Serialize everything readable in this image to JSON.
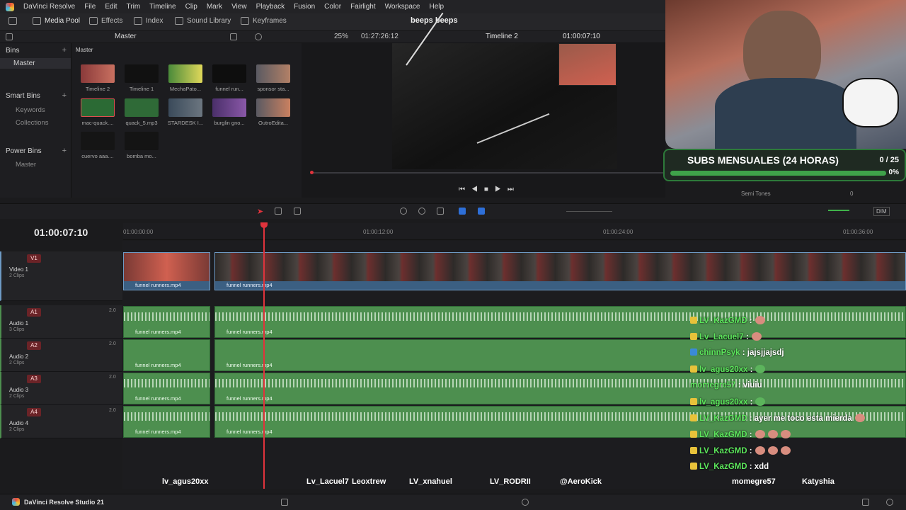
{
  "menu": {
    "app_name": "DaVinci Resolve",
    "items": [
      "File",
      "Edit",
      "Trim",
      "Timeline",
      "Clip",
      "Mark",
      "View",
      "Playback",
      "Fusion",
      "Color",
      "Fairlight",
      "Workspace",
      "Help"
    ]
  },
  "toolbar": {
    "media_pool": "Media Pool",
    "effects": "Effects",
    "index": "Index",
    "sound_library": "Sound Library",
    "keyframes": "Keyframes",
    "project_title": "beeps beeps"
  },
  "subbar": {
    "bin_path": "Master",
    "zoom": "25%",
    "source_tc": "01:27:26:12",
    "timeline_name": "Timeline 2",
    "record_tc": "01:00:07:10"
  },
  "bins": {
    "header": "Bins",
    "master": "Master",
    "smart_bins": "Smart Bins",
    "keywords": "Keywords",
    "collections": "Collections",
    "power_bins": "Power Bins",
    "power_master": "Master"
  },
  "pool": {
    "header": "Master",
    "clips": [
      "Timeline 2",
      "Timeline 1",
      "MechaPato...",
      "funnel run...",
      "sponsor sta...",
      "mac-quack....",
      "quack_5.mp3",
      "STARDESK I...",
      "burglin gno...",
      "OutroEdita...",
      "cuervo aaa....",
      "bomba mo..."
    ]
  },
  "viewer": {
    "semi_tones_label": "Semi Tones",
    "semi_tones_value": "0"
  },
  "overlay": {
    "subs_title": "SUBS MENSUALES (24 HORAS)",
    "subs_count": "0 / 25",
    "subs_percent": "0%",
    "subs_progress": 0.0
  },
  "timeline": {
    "timecode": "01:00:07:10",
    "ruler": [
      "01:00:00:00",
      "01:00:12:00",
      "01:00:24:00",
      "01:00:36:00"
    ],
    "dim": "DIM",
    "tracks": [
      {
        "id": "V1",
        "name": "Video 1",
        "clips": "2 Clips"
      },
      {
        "id": "A1",
        "name": "Audio 1",
        "clips": "3 Clips",
        "level": "2.0"
      },
      {
        "id": "A2",
        "name": "Audio 2",
        "clips": "2 Clips",
        "level": "2.0"
      },
      {
        "id": "A3",
        "name": "Audio 3",
        "clips": "2 Clips",
        "level": "2.0"
      },
      {
        "id": "A4",
        "name": "Audio 4",
        "clips": "2 Clips",
        "level": "2.0"
      }
    ],
    "clip_name": "funnel runners.mp4"
  },
  "chat": [
    {
      "nick": "LV_KazGMD",
      "msg": ":"
    },
    {
      "nick": "Lv_Lacuel7",
      "msg": ":"
    },
    {
      "nick": "chinnPsyk",
      "msg": ": jajsjjajsdj"
    },
    {
      "nick": "lv_agus20xx",
      "msg": ":"
    },
    {
      "nick": "momegre57",
      "msg": ": viuiu"
    },
    {
      "nick": "lv_agus20xx",
      "msg": ":"
    },
    {
      "nick": "LV_KazGMD",
      "msg": ": ayer me toco esta mierda"
    },
    {
      "nick": "LV_KazGMD",
      "msg": ":"
    },
    {
      "nick": "LV_KazGMD",
      "msg": ":"
    },
    {
      "nick": "LV_KazGMD",
      "msg": ": xdd"
    }
  ],
  "viewers": [
    "lv_agus20xx",
    "Lv_Lacuel7",
    "Leoxtrew",
    "LV_xnahuel",
    "LV_RODRII",
    "@AeroKick",
    "momegre57",
    "Katyshia"
  ],
  "taskbar": {
    "app": "DaVinci Resolve Studio 21"
  },
  "colors": {
    "accent": "#2d7a3a",
    "playhead": "#e0333c",
    "video_clip": "#3b5f82",
    "audio_clip": "#4d8f4f"
  }
}
